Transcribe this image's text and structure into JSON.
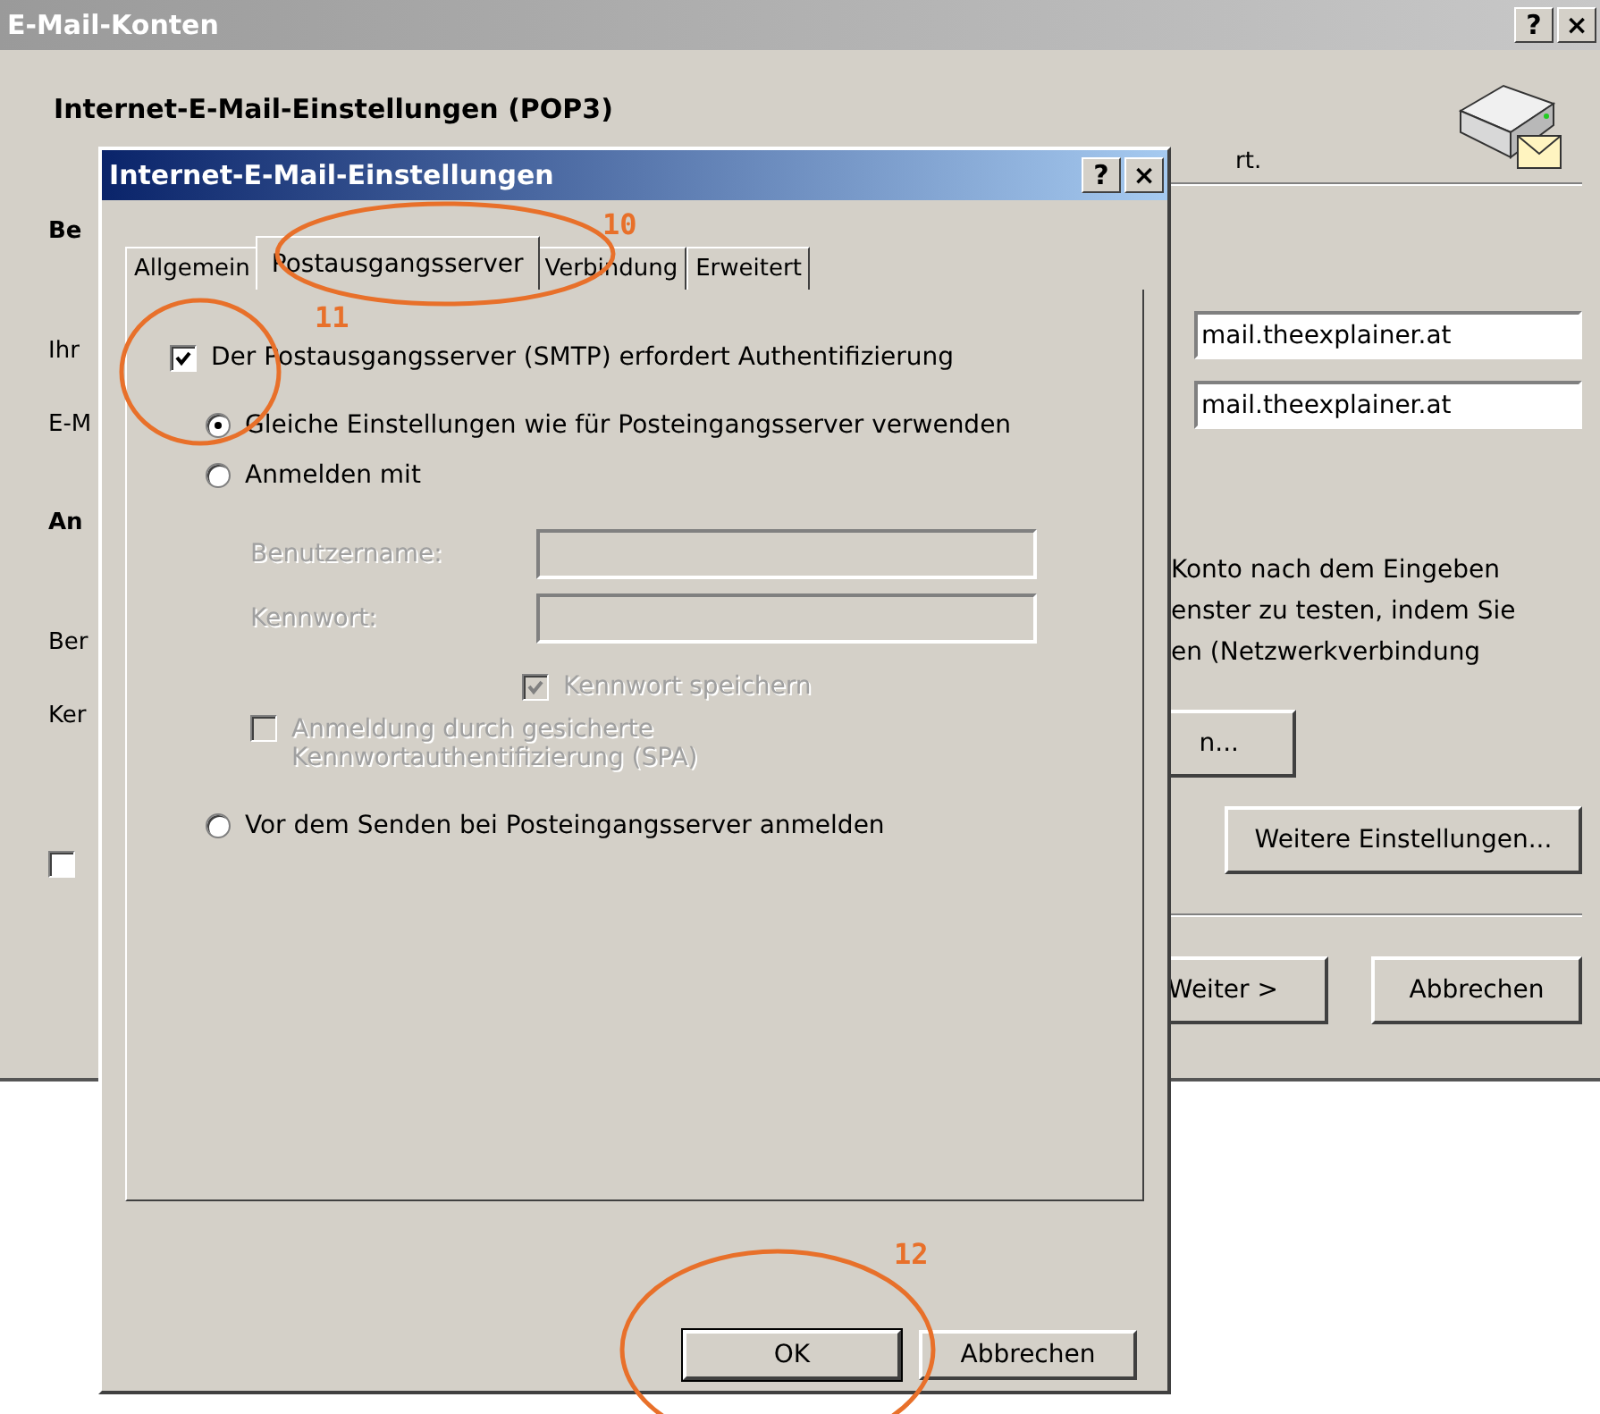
{
  "background_window": {
    "title": "E-Mail-Konten",
    "title_buttons": [
      "?",
      "×"
    ],
    "heading": "Internet-E-Mail-Einstellungen (POP3)",
    "subtitle_fragment": "rt.",
    "left_column": [
      {
        "kind": "heading",
        "text": "Be"
      },
      {
        "kind": "label",
        "text": "Ihr"
      },
      {
        "kind": "label",
        "text": "E-M"
      },
      {
        "kind": "heading",
        "text": "An"
      },
      {
        "kind": "label",
        "text": "Ber"
      },
      {
        "kind": "label",
        "text": "Ker"
      },
      {
        "kind": "checkbox",
        "checked": false
      }
    ],
    "fields": [
      "mail.theexplainer.at",
      "mail.theexplainer.at"
    ],
    "note_lines": [
      "Konto nach dem Eingeben",
      "enster zu testen, indem Sie",
      "en (Netzwerkverbindung"
    ],
    "partial_button": "n...",
    "more_settings_button": "Weitere Einstellungen...",
    "buttons": [
      "Weiter >",
      "Abbrechen"
    ]
  },
  "dialog": {
    "title": "Internet-E-Mail-Einstellungen",
    "title_buttons": [
      "?",
      "×"
    ],
    "tabs": [
      {
        "label": "Allgemein",
        "selected": false
      },
      {
        "label": "Postausgangsserver",
        "selected": true
      },
      {
        "label": "Verbindung",
        "selected": false
      },
      {
        "label": "Erweitert",
        "selected": false
      }
    ],
    "options": [
      {
        "kind": "checkbox",
        "label": "Der Postausgangsserver (SMTP) erfordert Authentifizierung",
        "checked": true,
        "disabled": false,
        "children": [
          {
            "kind": "radio",
            "label": "Gleiche Einstellungen wie für Posteingangsserver verwenden",
            "selected": true,
            "disabled": false
          },
          {
            "kind": "radio",
            "label": "Anmelden mit",
            "selected": false,
            "disabled": false,
            "children": [
              {
                "kind": "field",
                "label": "Benutzername:",
                "disabled": true
              },
              {
                "kind": "field",
                "label": "Kennwort:",
                "disabled": true
              },
              {
                "kind": "field-checkbox",
                "label": "Kennwort speichern",
                "checked": true,
                "disabled": true
              },
              {
                "kind": "checkbox",
                "label": "Anmeldung durch gesicherte Kennwortauthentifizierung (SPA)",
                "checked": false,
                "disabled": true
              }
            ]
          },
          {
            "kind": "radio",
            "label": "Vor dem Senden bei Posteingangsserver anmelden",
            "selected": false,
            "disabled": false
          }
        ]
      }
    ],
    "buttons": [
      "OK",
      "Abbrechen"
    ]
  },
  "annotations": [
    {
      "label": "10"
    },
    {
      "label": "11"
    },
    {
      "label": "12"
    }
  ]
}
